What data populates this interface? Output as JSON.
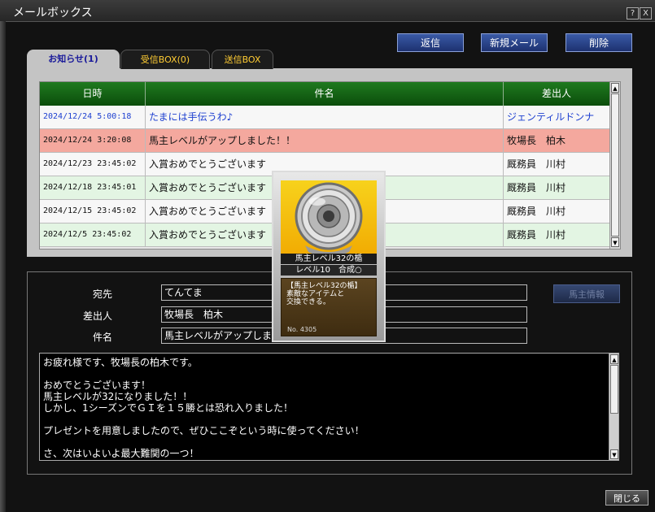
{
  "window": {
    "title": "メールボックス",
    "help_label": "?",
    "close_label": "X"
  },
  "actions": {
    "reply": "返信",
    "new_mail": "新規メール",
    "delete": "削除"
  },
  "tabs": [
    {
      "label": "お知らせ(1)",
      "active": true
    },
    {
      "label": "受信BOX(0)",
      "active": false
    },
    {
      "label": "送信BOX",
      "active": false
    }
  ],
  "table": {
    "columns": [
      "日時",
      "件名",
      "差出人"
    ],
    "rows": [
      {
        "date": "2024/12/24 5:00:18",
        "subject": "たまには手伝うわ♪",
        "sender": "ジェンティルドンナ"
      },
      {
        "date": "2024/12/24 3:20:08",
        "subject": "馬主レベルがアップしました！！",
        "sender": "牧場長　柏木"
      },
      {
        "date": "2024/12/23 23:45:02",
        "subject": "入賞おめでとうございます",
        "sender": "厩務員　川村"
      },
      {
        "date": "2024/12/18 23:45:01",
        "subject": "入賞おめでとうございます",
        "sender": "厩務員　川村"
      },
      {
        "date": "2024/12/15 23:45:02",
        "subject": "入賞おめでとうございます",
        "sender": "厩務員　川村"
      },
      {
        "date": "2024/12/5 23:45:02",
        "subject": "入賞おめでとうございます",
        "sender": "厩務員　川村"
      }
    ]
  },
  "detail": {
    "to_label": "宛先",
    "to_value": "てんてま",
    "from_label": "差出人",
    "from_value": "牧場長　柏木",
    "subject_label": "件名",
    "subject_value": "馬主レベルがアップしました！！",
    "owner_info_button": "馬主情報",
    "body_lines": [
      "お疲れ様です、牧場長の柏木です。",
      "",
      "おめでとうございます！",
      "馬主レベルが32になりました！！",
      "しかし、1シーズンでＧＩを１５勝とは恐れ入りました！",
      "",
      "プレゼントを用意しましたので、ぜひここぞという時に使ってください！",
      "",
      "さ、次はいよいよ最大難関の一つ！"
    ]
  },
  "item_card": {
    "name": "馬主レベル32の楯",
    "level": "レベル10　合成○",
    "description": "【馬主レベル32の楯】\n素敵なアイテムと\n交換できる。",
    "number": "No. 4305"
  },
  "footer": {
    "close": "閉じる"
  },
  "colors": {
    "header_green": "#0b4d0b",
    "row_highlight": "#f4a89e",
    "row_alt": "#e3f5e3",
    "button_blue": "#2a438a",
    "tab_active_text": "#1a1a9a",
    "tab_inactive_text": "#ffcc33"
  }
}
